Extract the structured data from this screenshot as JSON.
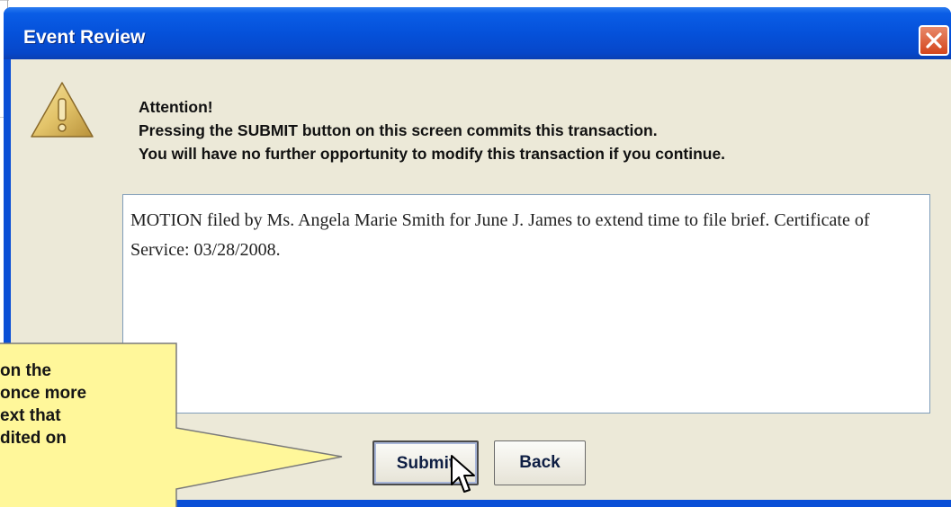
{
  "dialog": {
    "title": "Event Review",
    "attention": "Attention!",
    "message_line1": "Pressing the SUBMIT button on this screen commits this transaction.",
    "message_line2": "You will have no further opportunity to modify this transaction if you continue.",
    "docket_text": "MOTION filed by Ms. Angela Marie Smith for June J. James to extend time to file brief. Certificate of Service: 03/28/2008.",
    "submit_label": "Submit",
    "back_label": "Back"
  },
  "callout": {
    "lines": [
      " on the",
      "once more",
      "ext that",
      "dited on"
    ]
  },
  "icons": {
    "warning": "warning-icon",
    "close": "close-icon",
    "cursor": "mouse-pointer-icon"
  },
  "colors": {
    "titlebar": "#0551da",
    "client_bg": "#ece9d8",
    "close_button": "#d4451c",
    "callout_fill": "#fff79a"
  }
}
